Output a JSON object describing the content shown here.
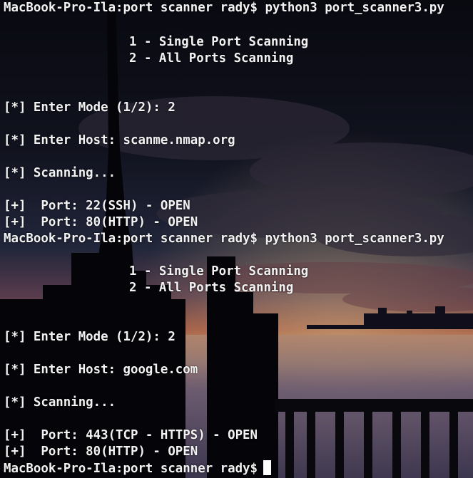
{
  "session1": {
    "prompt": "MacBook-Pro-Ila:port scanner rady$ python3 port_scanner3.py",
    "menu": [
      "1 - Single Port Scanning",
      "2 - All Ports Scanning"
    ],
    "mode": "[*] Enter Mode (1/2): 2",
    "host": "[*] Enter Host: scanme.nmap.org",
    "scanning": "[*] Scanning...",
    "results": [
      "[+]  Port: 22(SSH) - OPEN",
      "[+]  Port: 80(HTTP) - OPEN"
    ]
  },
  "session2": {
    "prompt": "MacBook-Pro-Ila:port scanner rady$ python3 port_scanner3.py",
    "menu": [
      "1 - Single Port Scanning",
      "2 - All Ports Scanning"
    ],
    "mode": "[*] Enter Mode (1/2): 2",
    "host": "[*] Enter Host: google.com",
    "scanning": "[*] Scanning...",
    "results": [
      "[+]  Port: 443(TCP - HTTPS) - OPEN",
      "[+]  Port: 80(HTTP) - OPEN"
    ]
  },
  "final_prompt": "MacBook-Pro-Ila:port scanner rady$"
}
